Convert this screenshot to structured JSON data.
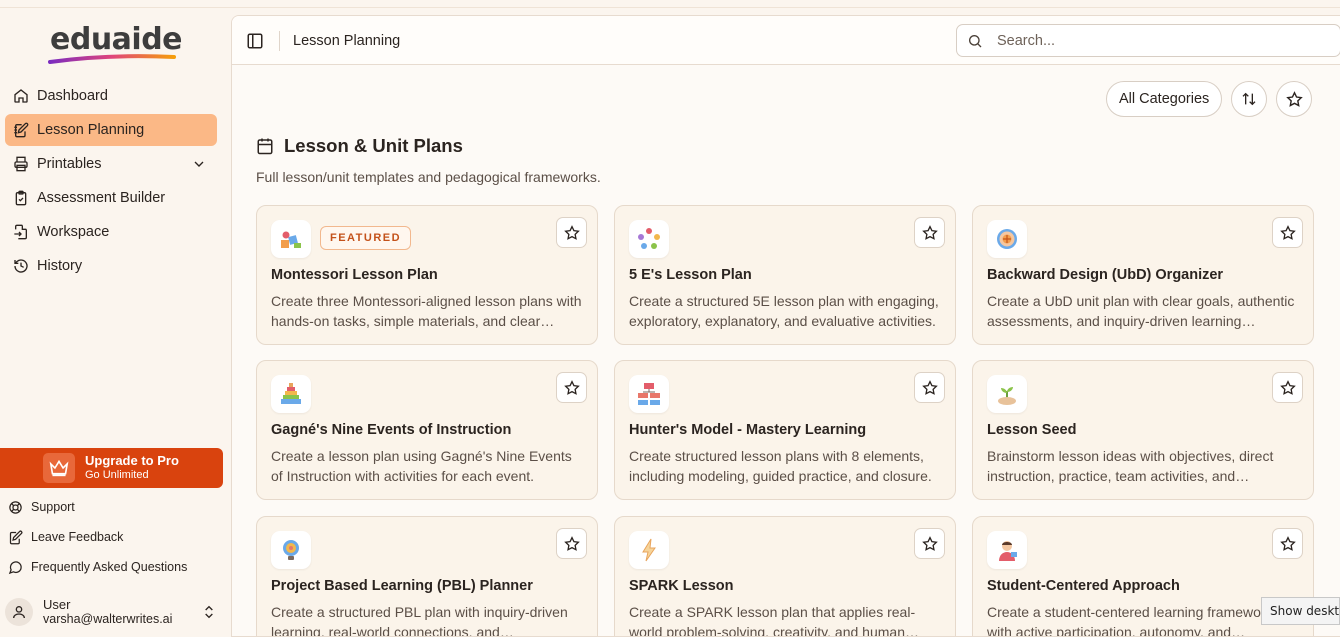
{
  "app": {
    "logo_text": "eduaide"
  },
  "sidebar": {
    "items": [
      {
        "label": "Dashboard",
        "icon": "home-icon"
      },
      {
        "label": "Lesson Planning",
        "icon": "notebook-pen-icon",
        "active": true
      },
      {
        "label": "Printables",
        "icon": "printer-icon",
        "expandable": true
      },
      {
        "label": "Assessment Builder",
        "icon": "clipboard-check-icon"
      },
      {
        "label": "Workspace",
        "icon": "file-export-icon"
      },
      {
        "label": "History",
        "icon": "history-icon"
      }
    ],
    "upgrade": {
      "title": "Upgrade to Pro",
      "subtitle": "Go Unlimited",
      "icon": "crown-icon"
    },
    "links": [
      {
        "label": "Support",
        "icon": "support-icon"
      },
      {
        "label": "Leave Feedback",
        "icon": "feedback-icon"
      },
      {
        "label": "Frequently Asked Questions",
        "icon": "chat-icon"
      }
    ],
    "user": {
      "name": "User",
      "email": "varsha@walterwrites.ai"
    }
  },
  "header": {
    "title": "Lesson Planning",
    "search_placeholder": "Search..."
  },
  "filters": {
    "category_label": "All Categories"
  },
  "section": {
    "title": "Lesson & Unit Plans",
    "description": "Full lesson/unit templates and pedagogical frameworks."
  },
  "badge_featured": "FEATURED",
  "cards": [
    {
      "title": "Montessori Lesson Plan",
      "description": "Create three Montessori-aligned lesson plans with hands-on tasks, simple materials, and clear objectives.",
      "featured": true,
      "icon": "blocks-icon"
    },
    {
      "title": "5 E's Lesson Plan",
      "description": "Create a structured 5E lesson plan with engaging, exploratory, explanatory, and evaluative activities.",
      "icon": "cycle-icon"
    },
    {
      "title": "Backward Design (UbD) Organizer",
      "description": "Create a UbD unit plan with clear goals, authentic assessments, and inquiry-driven learning activities.",
      "icon": "target-icon"
    },
    {
      "title": "Gagné's Nine Events of Instruction",
      "description": "Create a lesson plan using Gagné's Nine Events of Instruction with activities for each event.",
      "icon": "pyramid-icon"
    },
    {
      "title": "Hunter's Model - Mastery Learning",
      "description": "Create structured lesson plans with 8 elements, including modeling, guided practice, and closure.",
      "icon": "org-chart-icon"
    },
    {
      "title": "Lesson Seed",
      "description": "Brainstorm lesson ideas with objectives, direct instruction, practice, team activities, and assessments.",
      "icon": "sprout-icon"
    },
    {
      "title": "Project Based Learning (PBL) Planner",
      "description": "Create a structured PBL plan with inquiry-driven learning, real-world connections, and presentations.",
      "icon": "lightbulb-gear-icon"
    },
    {
      "title": "SPARK Lesson",
      "description": "Create a SPARK lesson plan that applies real-world problem-solving, creativity, and human connection.",
      "icon": "spark-icon"
    },
    {
      "title": "Student-Centered Approach",
      "description": "Create a student-centered learning framework with active participation, autonomy, and collaboration.",
      "icon": "student-icon"
    }
  ],
  "tooltip": "Show deskto"
}
